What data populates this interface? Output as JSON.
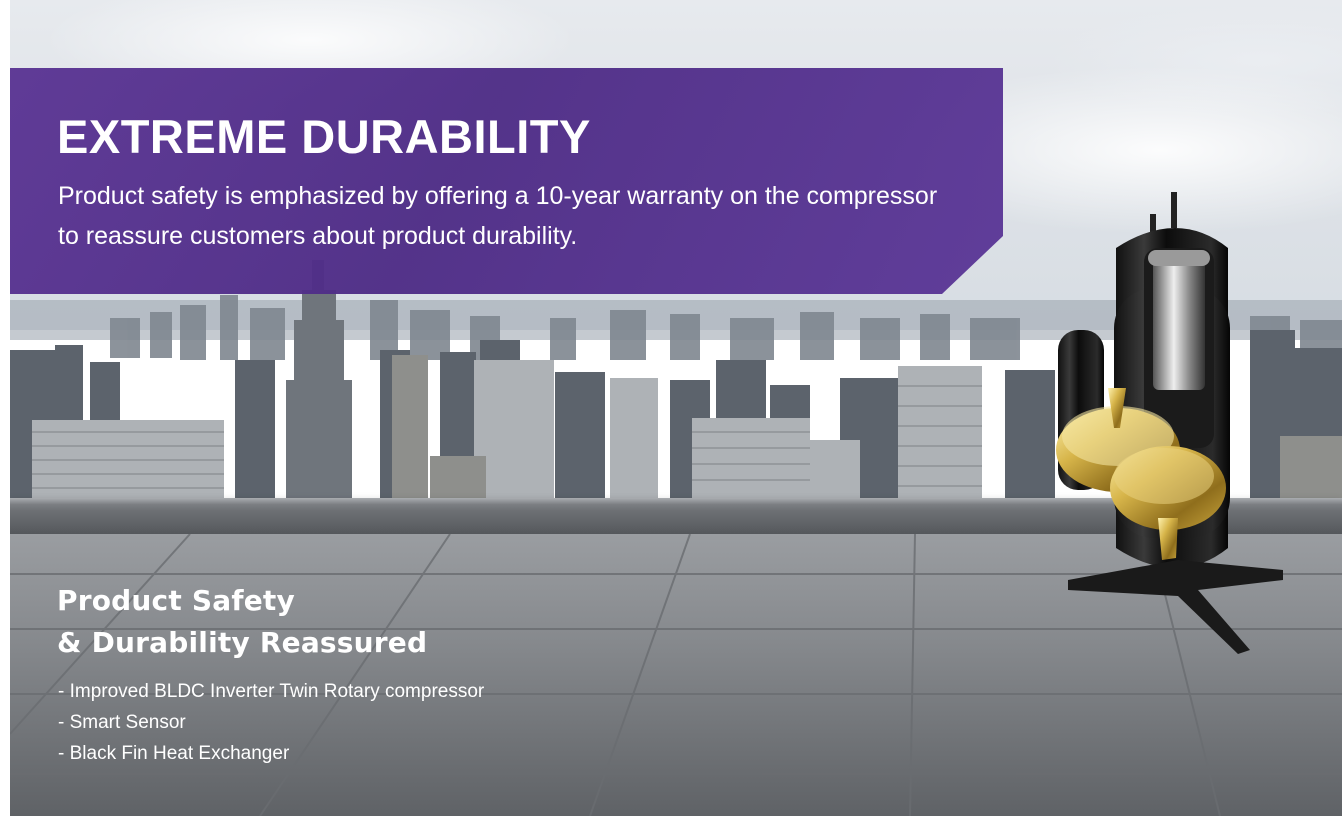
{
  "banner": {
    "title": "EXTREME DURABILITY",
    "description": "Product safety is emphasized by offering a 10-year warranty on the compressor to reassure customers about product durability.",
    "background_color": "#52308c"
  },
  "safety": {
    "title_line1": "Product Safety",
    "title_line2": "& Durability Reassured",
    "features": [
      "- Improved BLDC Inverter Twin Rotary compressor",
      "- Smart Sensor",
      "- Black Fin Heat Exchanger"
    ]
  },
  "images": {
    "background": "city-skyline-rooftop-image",
    "product": "twin-rotary-compressor-image"
  }
}
